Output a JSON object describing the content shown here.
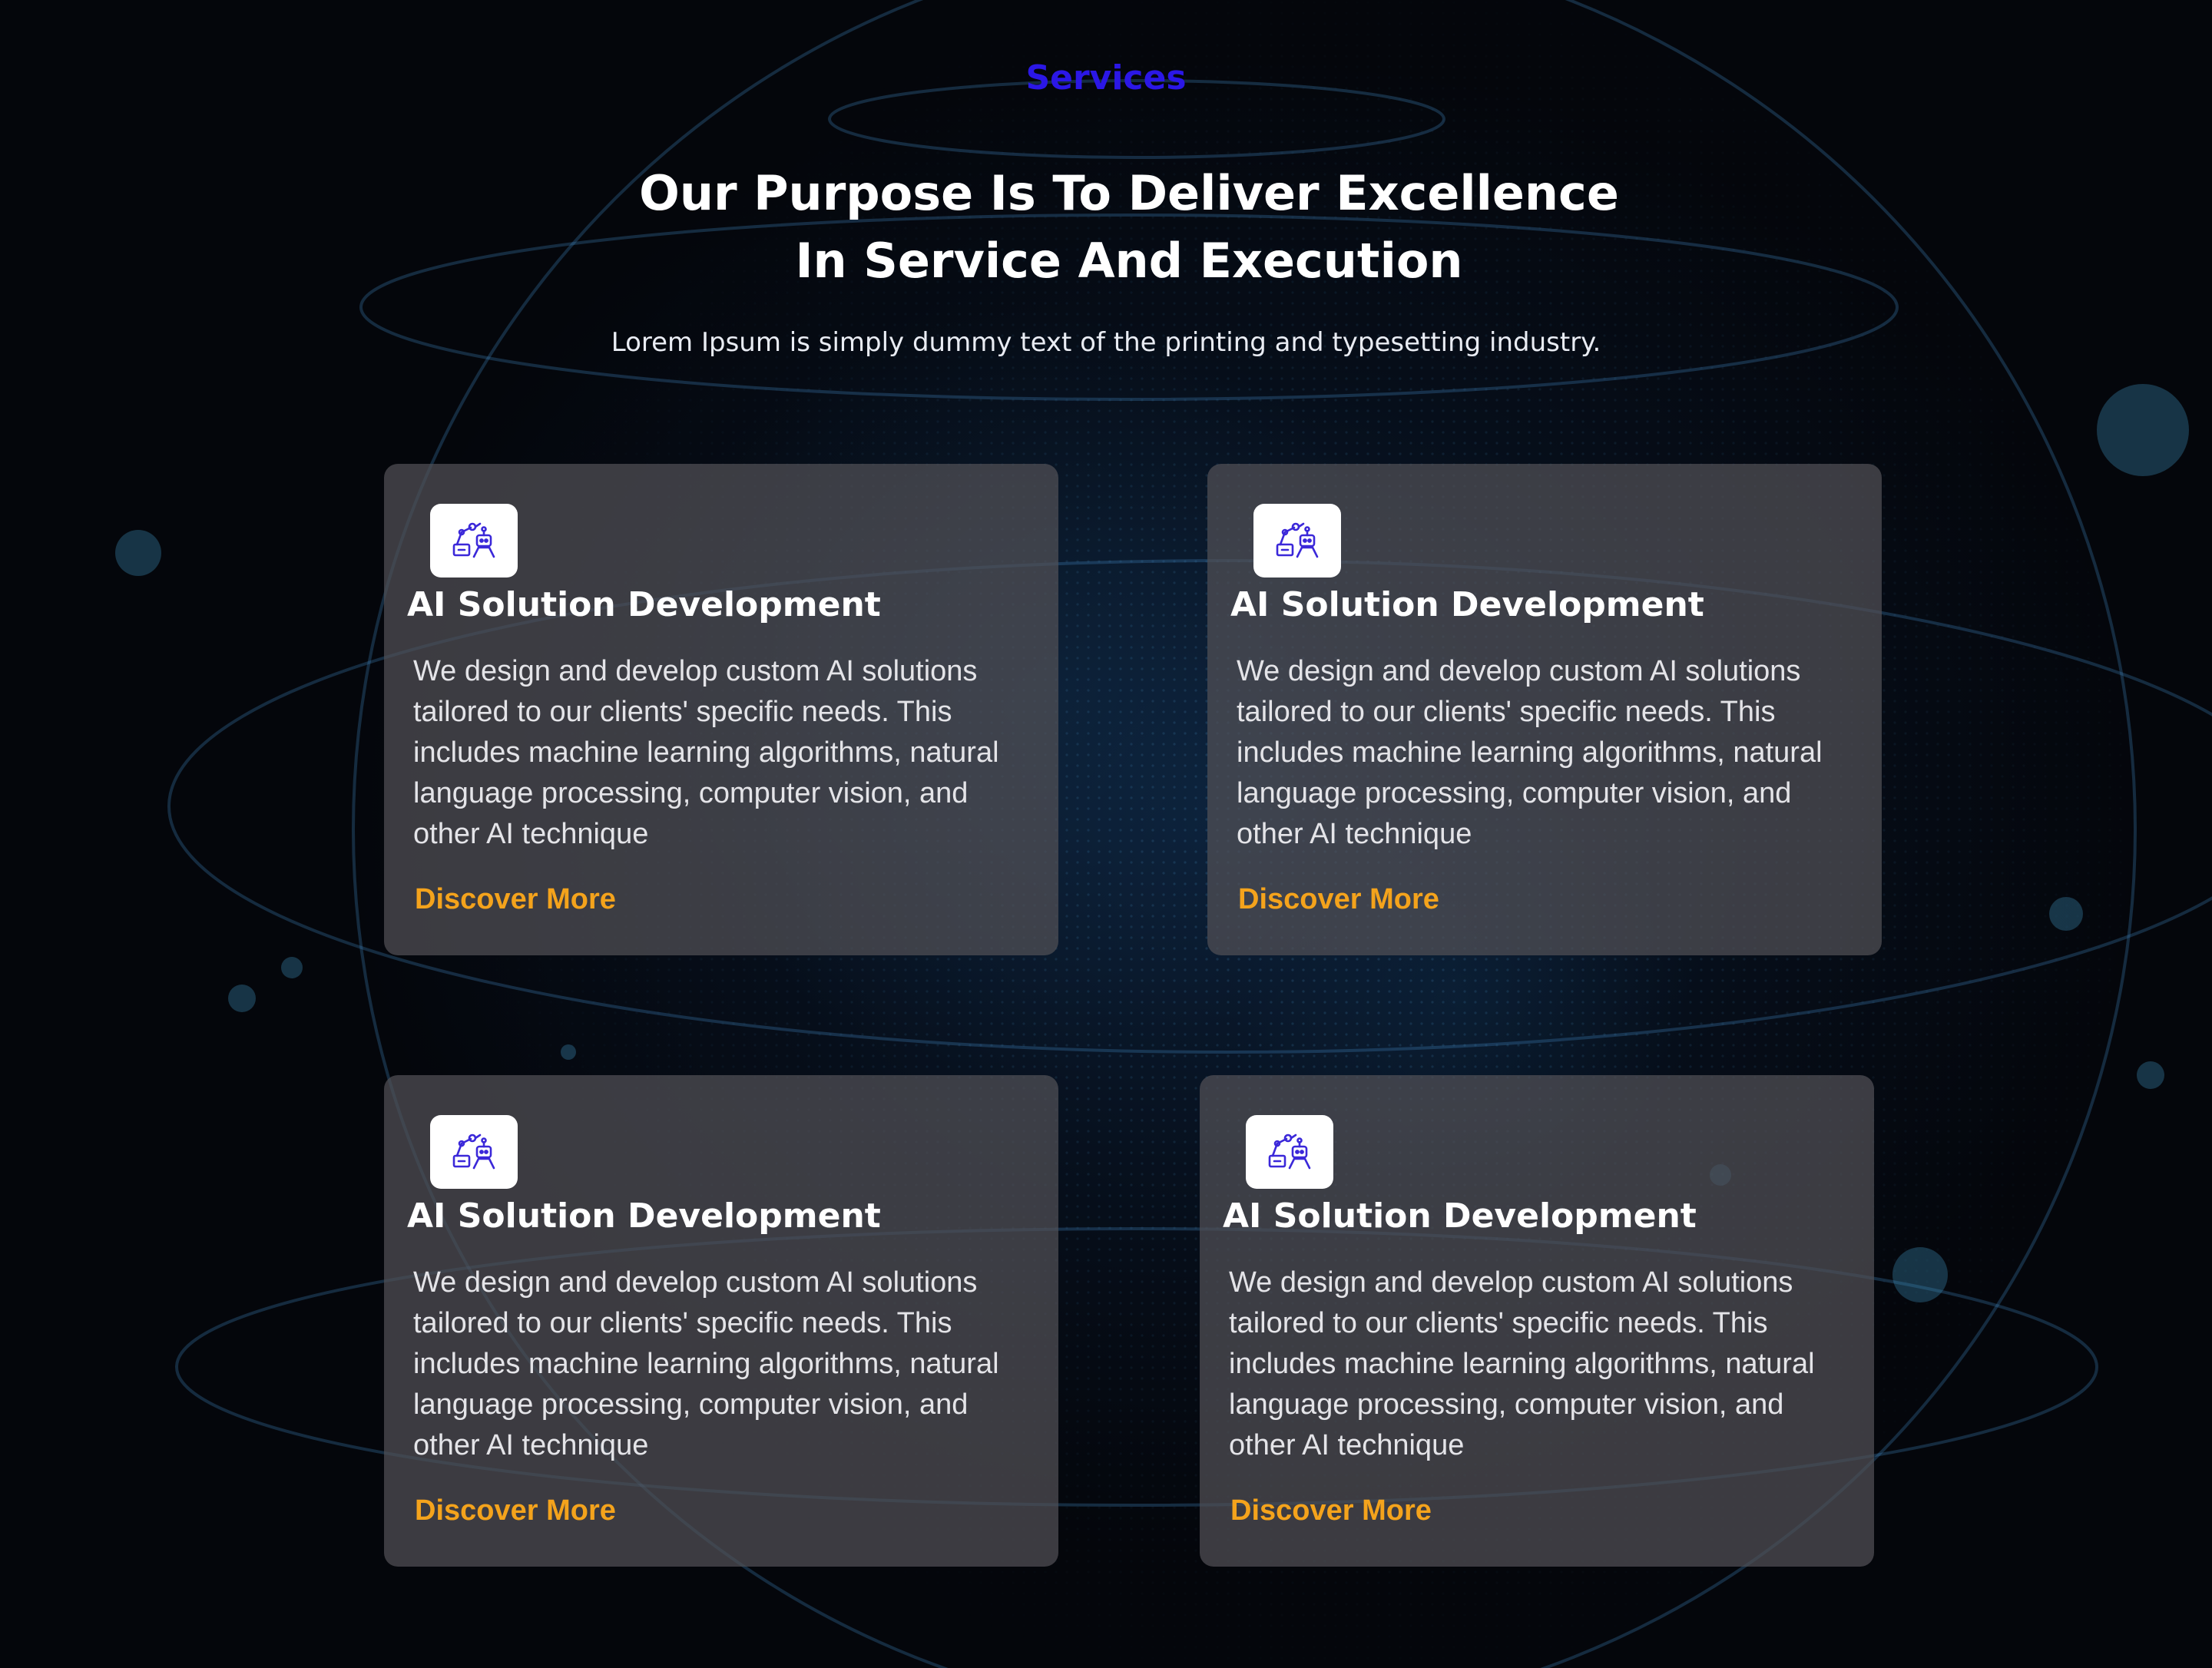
{
  "header": {
    "eyebrow": "Services",
    "headline_line1": "Our Purpose Is To Deliver Excellence",
    "headline_line2": "In Service And Execution",
    "subtitle": "Lorem Ipsum is simply dummy text of the printing and typesetting industry."
  },
  "colors": {
    "eyebrow": "#2b17e6",
    "link": "#f4a31c",
    "icon": "#3b28d9"
  },
  "services": [
    {
      "icon": "ai-robot-icon",
      "title": "AI Solution Development",
      "description": "We design and develop custom AI solutions tailored to our clients' specific needs. This includes machine learning algorithms, natural language processing, computer vision, and other AI technique",
      "link": "Discover More"
    },
    {
      "icon": "ai-robot-icon",
      "title": "AI Solution Development",
      "description": "We design and develop custom AI solutions tailored to our clients' specific needs. This includes machine learning algorithms, natural language processing, computer vision, and other AI technique",
      "link": "Discover More"
    },
    {
      "icon": "ai-robot-icon",
      "title": "AI Solution Development",
      "description": "We design and develop custom AI solutions tailored to our clients' specific needs. This includes machine learning algorithms, natural language processing, computer vision, and other AI technique",
      "link": "Discover More"
    },
    {
      "icon": "ai-robot-icon",
      "title": "AI Solution Development",
      "description": "We design and develop custom AI solutions tailored to our clients' specific needs. This includes machine learning algorithms, natural language processing, computer vision, and other AI technique",
      "link": "Discover More"
    }
  ]
}
